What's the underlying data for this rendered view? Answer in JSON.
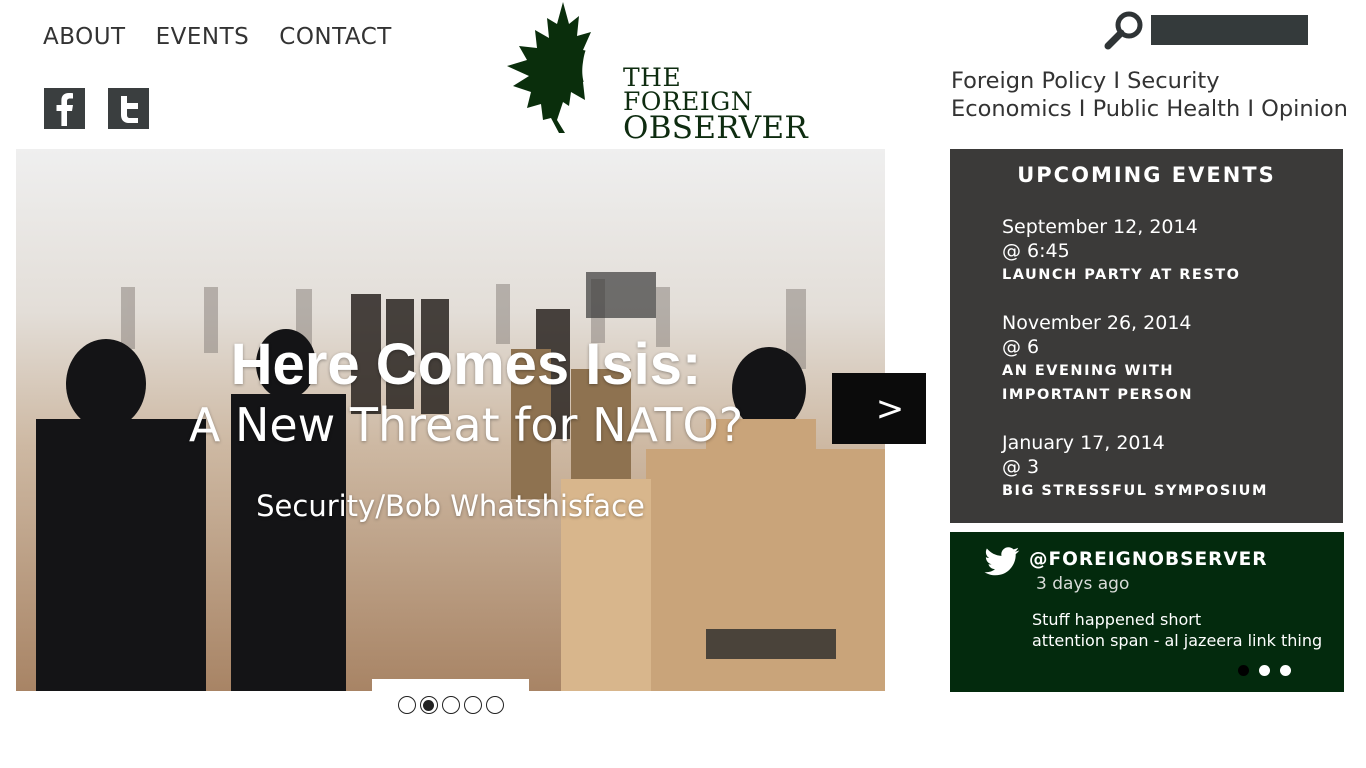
{
  "nav": {
    "items": [
      {
        "label": "ABOUT"
      },
      {
        "label": "EVENTS"
      },
      {
        "label": "CONTACT"
      }
    ]
  },
  "social": [
    {
      "icon": "facebook-icon"
    },
    {
      "icon": "twitter-icon"
    }
  ],
  "logo": {
    "line1": "THE FOREIGN",
    "line2": "OBSERVER",
    "color": "#0e2c10"
  },
  "search": {
    "icon": "search-icon",
    "value": "",
    "placeholder": ""
  },
  "categories": {
    "line1": "Foreign Policy  I Security",
    "line2": "Economics I Public Health I Opinion"
  },
  "hero": {
    "title": "Here Comes Isis:",
    "subtitle": "A New Threat for NATO?",
    "byline": "Security/Bob Whatshisface",
    "next_label": ">",
    "slides": 5,
    "active_slide": 2
  },
  "events": {
    "heading": "UPCOMING EVENTS",
    "items": [
      {
        "date": "September 12, 2014",
        "time": "@ 6:45",
        "name": "LAUNCH PARTY AT RESTO"
      },
      {
        "date": "November 26, 2014",
        "time": "@ 6",
        "name": "AN EVENING WITH IMPORTANT PERSON"
      },
      {
        "date": "January 17, 2014",
        "time": "@ 3",
        "name": "BIG STRESSFUL SYMPOSIUM"
      }
    ]
  },
  "twitter": {
    "handle": "@FOREIGNOBSERVER",
    "time": "3 days ago",
    "text_line1": "Stuff happened short",
    "text_line2": "attention span - al jazeera link thing",
    "active_dot": 1,
    "dot_count": 3
  },
  "colors": {
    "brand_green": "#032a0d",
    "events_bg": "#3b3a39",
    "dark_button": "#0b0b0b"
  }
}
